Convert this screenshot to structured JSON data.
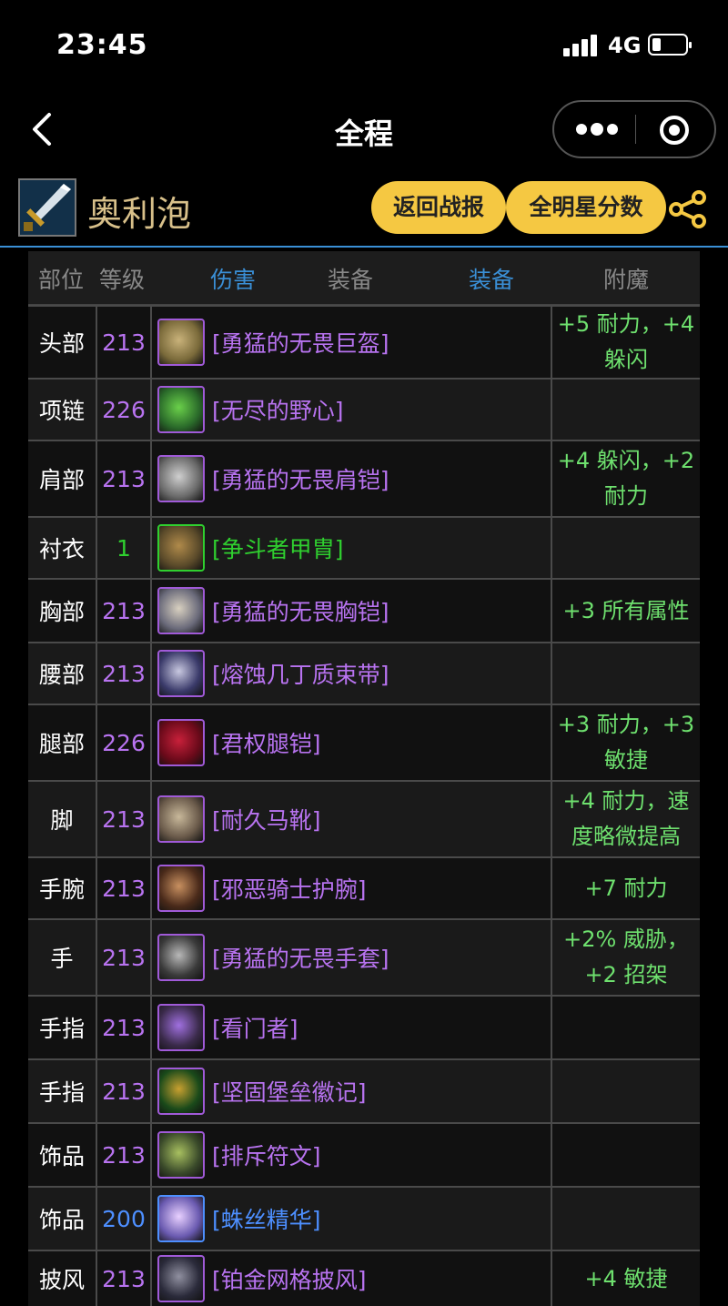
{
  "status": {
    "time": "23:45",
    "network": "4G",
    "battery_level": 0.25
  },
  "nav": {
    "title": "全程"
  },
  "character": {
    "name": "奥利泡",
    "report_button": "返回战报",
    "stars_button": "全明星分数"
  },
  "table": {
    "headers": {
      "slot": "部位",
      "level": "等级",
      "damage": "伤害",
      "gear1": "装备",
      "gear2": "装备",
      "enchant": "附魔"
    },
    "rows": [
      {
        "slot": "头部",
        "level": "213",
        "item": "[勇猛的无畏巨盔]",
        "quality": "epic",
        "enchant": "+5 耐力，+4躲闪"
      },
      {
        "slot": "项链",
        "level": "226",
        "item": "[无尽的野心]",
        "quality": "epic",
        "enchant": ""
      },
      {
        "slot": "肩部",
        "level": "213",
        "item": "[勇猛的无畏肩铠]",
        "quality": "epic",
        "enchant": "+4 躲闪，+2耐力"
      },
      {
        "slot": "衬衣",
        "level": "1",
        "item": "[争斗者甲胄]",
        "quality": "uncommon",
        "enchant": ""
      },
      {
        "slot": "胸部",
        "level": "213",
        "item": "[勇猛的无畏胸铠]",
        "quality": "epic",
        "enchant": "+3 所有属性"
      },
      {
        "slot": "腰部",
        "level": "213",
        "item": "[熔蚀几丁质束带]",
        "quality": "epic",
        "enchant": ""
      },
      {
        "slot": "腿部",
        "level": "226",
        "item": "[君权腿铠]",
        "quality": "epic",
        "enchant": "+3 耐力，+3敏捷"
      },
      {
        "slot": "脚",
        "level": "213",
        "item": "[耐久马靴]",
        "quality": "epic",
        "enchant": "+4 耐力，速度略微提高"
      },
      {
        "slot": "手腕",
        "level": "213",
        "item": "[邪恶骑士护腕]",
        "quality": "epic",
        "enchant": "+7 耐力"
      },
      {
        "slot": "手",
        "level": "213",
        "item": "[勇猛的无畏手套]",
        "quality": "epic",
        "enchant": "+2% 威胁，+2 招架"
      },
      {
        "slot": "手指",
        "level": "213",
        "item": "[看门者]",
        "quality": "epic",
        "enchant": ""
      },
      {
        "slot": "手指",
        "level": "213",
        "item": "[坚固堡垒徽记]",
        "quality": "epic",
        "enchant": ""
      },
      {
        "slot": "饰品",
        "level": "213",
        "item": "[排斥符文]",
        "quality": "epic",
        "enchant": ""
      },
      {
        "slot": "饰品",
        "level": "200",
        "item": "[蛛丝精华]",
        "quality": "rare",
        "enchant": ""
      },
      {
        "slot": "披风",
        "level": "213",
        "item": "[铂金网格披风]",
        "quality": "epic",
        "enchant": "+4 敏捷"
      }
    ]
  },
  "colors": {
    "accent": "#f5c842",
    "epic": "#b873f0",
    "rare": "#4d8fff",
    "uncommon": "#2fd02f",
    "enchant": "#6ee06e",
    "header_blue": "#3a8fd6"
  },
  "icons": {
    "back": "chevron-left-icon",
    "more": "more-dots-icon",
    "close": "target-circle-icon",
    "share": "share-icon"
  }
}
